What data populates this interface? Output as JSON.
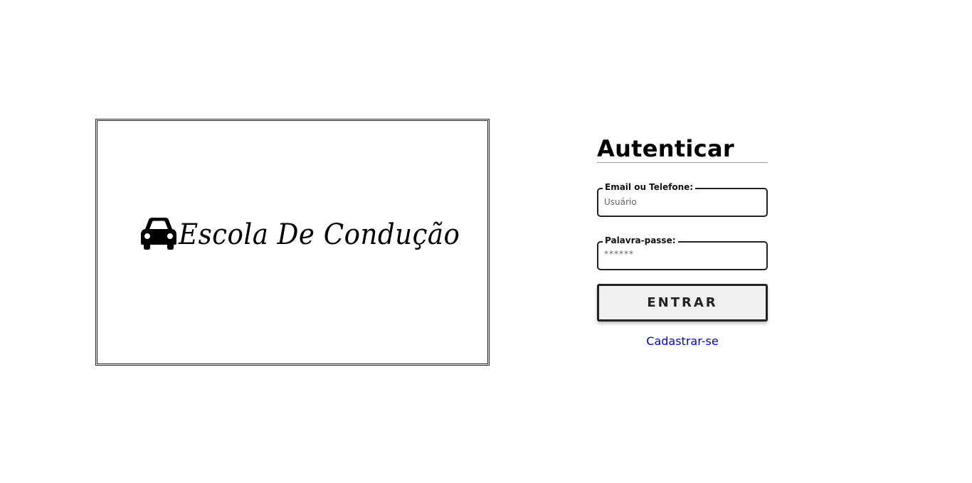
{
  "logo": {
    "text": "Escola De Condução",
    "icon": "car-icon"
  },
  "auth": {
    "title": "Autenticar",
    "email": {
      "label": "Email ou Telefone:",
      "placeholder": "Usuário",
      "value": ""
    },
    "password": {
      "label": "Palavra-passe:",
      "placeholder": "******",
      "value": ""
    },
    "submit_label": "ENTRAR",
    "register_label": "Cadastrar-se"
  },
  "colors": {
    "link": "#0000cc",
    "border": "#222222",
    "button_bg": "#f0f0f0"
  }
}
